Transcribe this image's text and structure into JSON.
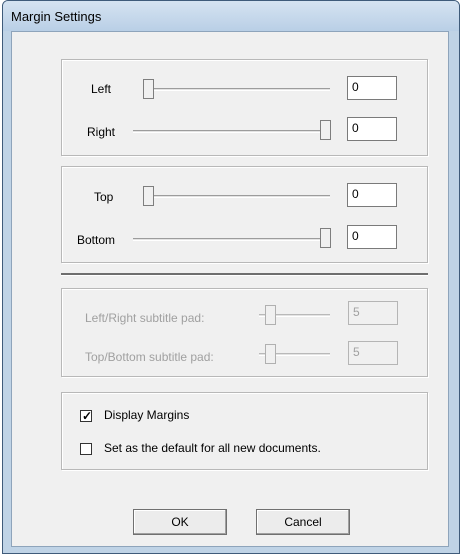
{
  "window": {
    "title": "Margin Settings"
  },
  "margins_lr": {
    "left": {
      "label": "Left",
      "value": "0",
      "slider_fraction": 0.0
    },
    "right": {
      "label": "Right",
      "value": "0",
      "slider_fraction": 1.0
    }
  },
  "margins_tb": {
    "top": {
      "label": "Top",
      "value": "0",
      "slider_fraction": 0.0
    },
    "bottom": {
      "label": "Bottom",
      "value": "0",
      "slider_fraction": 1.0
    }
  },
  "subtitle_pad": {
    "lr": {
      "label": "Left/Right subtitle pad:",
      "value": "5",
      "enabled": false
    },
    "tb": {
      "label": "Top/Bottom subtitle pad:",
      "value": "5",
      "enabled": false
    }
  },
  "options": {
    "display_margins": {
      "label": "Display Margins",
      "checked": true
    },
    "set_default": {
      "label": "Set as the default for all new documents.",
      "checked": false
    }
  },
  "buttons": {
    "ok": "OK",
    "cancel": "Cancel"
  }
}
